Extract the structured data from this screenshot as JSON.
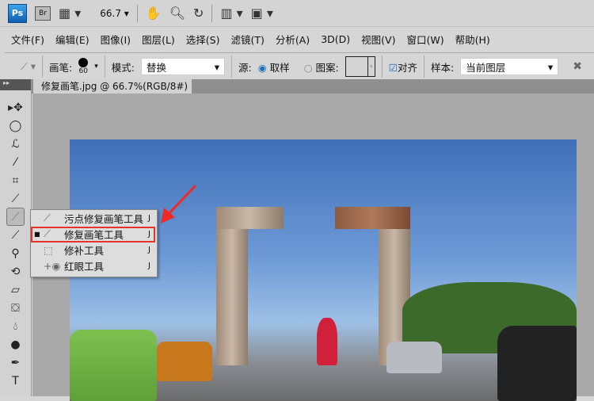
{
  "appbar": {
    "ps": "Ps",
    "br": "Br",
    "zoom": "66.7"
  },
  "menu": [
    "文件(F)",
    "编辑(E)",
    "图像(I)",
    "图层(L)",
    "选择(S)",
    "滤镜(T)",
    "分析(A)",
    "3D(D)",
    "视图(V)",
    "窗口(W)",
    "帮助(H)"
  ],
  "options": {
    "brush_label": "画笔:",
    "brush_size": "60",
    "mode_label": "模式:",
    "mode_value": "替换",
    "source_label": "源:",
    "sampled": "取样",
    "pattern": "图案:",
    "aligned": "对齐",
    "sample_label": "样本:",
    "sample_value": "当前图层"
  },
  "tab": {
    "title": "修复画笔.jpg @ 66.7%(RGB/8#)",
    "close": "×"
  },
  "flyout": [
    {
      "label": "污点修复画笔工具",
      "key": "J",
      "selected": false
    },
    {
      "label": "修复画笔工具",
      "key": "J",
      "selected": true
    },
    {
      "label": "修补工具",
      "key": "J",
      "selected": false
    },
    {
      "label": "红眼工具",
      "key": "J",
      "selected": false
    }
  ],
  "colors": {
    "highlight": "#e8322c"
  }
}
